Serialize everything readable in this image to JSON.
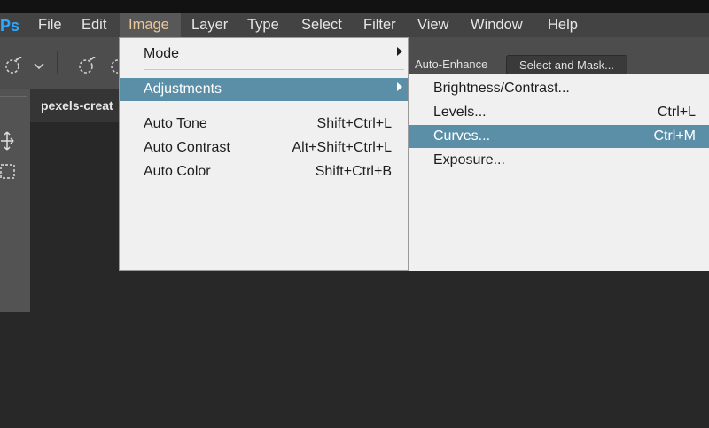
{
  "app": {
    "logo_text": "Ps"
  },
  "menubar": {
    "items": [
      {
        "label": "File"
      },
      {
        "label": "Edit"
      },
      {
        "label": "Image"
      },
      {
        "label": "Layer"
      },
      {
        "label": "Type"
      },
      {
        "label": "Select"
      },
      {
        "label": "Filter"
      },
      {
        "label": "View"
      },
      {
        "label": "Window"
      },
      {
        "label": "Help"
      }
    ],
    "active_item": "Image"
  },
  "options_bar": {
    "auto_enhance_label": "Auto-Enhance",
    "select_and_mask_label": "Select and Mask..."
  },
  "document": {
    "tab_title": "pexels-creat"
  },
  "image_menu": {
    "mode_label": "Mode",
    "adjustments_label": "Adjustments",
    "items": [
      {
        "label": "Auto Tone",
        "shortcut": "Shift+Ctrl+L"
      },
      {
        "label": "Auto Contrast",
        "shortcut": "Alt+Shift+Ctrl+L"
      },
      {
        "label": "Auto Color",
        "shortcut": "Shift+Ctrl+B"
      }
    ]
  },
  "adjustments_submenu": {
    "items": [
      {
        "label": "Brightness/Contrast...",
        "shortcut": ""
      },
      {
        "label": "Levels...",
        "shortcut": "Ctrl+L"
      },
      {
        "label": "Curves...",
        "shortcut": "Ctrl+M"
      },
      {
        "label": "Exposure...",
        "shortcut": ""
      }
    ],
    "highlighted": "Curves..."
  },
  "colors": {
    "menu_highlight": "#5b8fa8",
    "active_menu_text": "#e9c79a",
    "app_background": "#282828"
  }
}
